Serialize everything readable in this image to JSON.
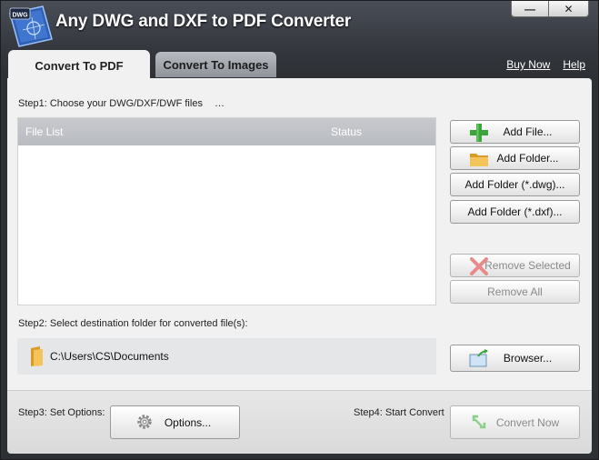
{
  "app": {
    "title": "Any DWG and DXF to PDF Converter",
    "logo_text": "DWG"
  },
  "window_controls": {
    "minimize": "—",
    "close": "✕"
  },
  "tabs": [
    {
      "label": "Convert To PDF",
      "active": true
    },
    {
      "label": "Convert To Images",
      "active": false
    }
  ],
  "links": {
    "buy_now": "Buy Now",
    "help": "Help"
  },
  "step1": {
    "label": "Step1: Choose your DWG/DXF/DWF files",
    "ellipsis": "…"
  },
  "file_list": {
    "col_file": "File List",
    "col_status": "Status",
    "rows": []
  },
  "buttons": {
    "add_file": "Add File...",
    "add_folder": "Add Folder...",
    "add_folder_dwg": "Add Folder (*.dwg)...",
    "add_folder_dxf": "Add Folder (*.dxf)...",
    "remove_selected": "Remove Selected",
    "remove_all": "Remove All",
    "browser": "Browser...",
    "options": "Options...",
    "convert_now": "Convert Now"
  },
  "step2": {
    "label": "Step2: Select destination folder for converted file(s):",
    "path": "C:\\Users\\CS\\Documents"
  },
  "step3": {
    "label": "Step3: Set Options:"
  },
  "step4": {
    "label": "Step4: Start Convert"
  },
  "colors": {
    "accent_green": "#3aa53a",
    "folder_yellow": "#e8b43a",
    "title_bg": "#33363c",
    "panel_bg": "#f1f1f1"
  },
  "icons": {
    "add_file": "plus-icon",
    "add_folder": "folder-icon",
    "remove_selected": "x-icon",
    "browser": "folder-arrow-icon",
    "options": "gear-icon",
    "convert_now": "convert-arrows-icon",
    "destination": "folder-icon"
  }
}
